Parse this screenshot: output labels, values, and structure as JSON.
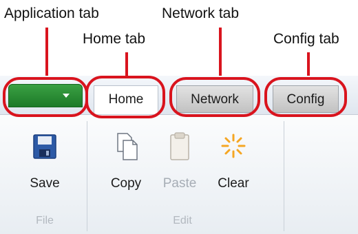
{
  "callouts": {
    "application": "Application tab",
    "home": "Home tab",
    "network": "Network tab",
    "config": "Config tab"
  },
  "tabs": {
    "home": "Home",
    "network": "Network",
    "config": "Config"
  },
  "buttons": {
    "save": "Save",
    "copy": "Copy",
    "paste": "Paste",
    "clear": "Clear"
  },
  "groups": {
    "file": "File",
    "edit": "Edit"
  },
  "icons": {
    "save": "floppy-disk-icon",
    "copy": "copy-icon",
    "paste": "clipboard-icon",
    "clear": "sparkle-icon",
    "dropdown": "dropdown-arrow-icon"
  },
  "colors": {
    "highlight": "#d9141e",
    "app_tab": "#2a8d35"
  }
}
